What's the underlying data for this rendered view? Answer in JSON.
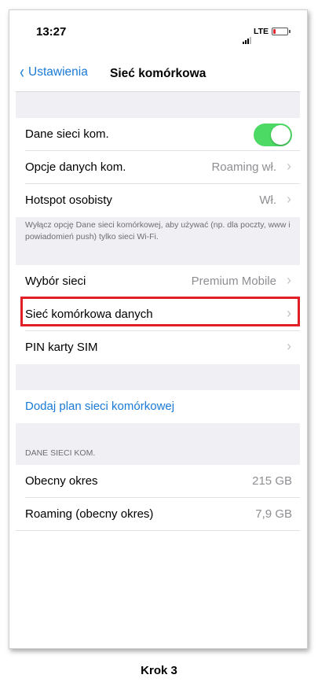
{
  "status": {
    "time": "13:27",
    "network": "LTE"
  },
  "nav": {
    "back_label": "Ustawienia",
    "title": "Sieć komórkowa"
  },
  "group1": [
    {
      "label": "Dane sieci kom.",
      "value": "",
      "toggle": true
    },
    {
      "label": "Opcje danych kom.",
      "value": "Roaming wł."
    },
    {
      "label": "Hotspot osobisty",
      "value": "Wł."
    }
  ],
  "note": "Wyłącz opcję Dane sieci komórkowej, aby używać (np. dla poczty, www i powiadomień push) tylko sieci Wi-Fi.",
  "group2": [
    {
      "label": "Wybór sieci",
      "value": "Premium Mobile"
    },
    {
      "label": "Sieć komórkowa danych",
      "value": ""
    },
    {
      "label": "PIN karty SIM",
      "value": ""
    }
  ],
  "add_plan": "Dodaj plan sieci komórkowej",
  "usage": {
    "header": "DANE SIECI KOM.",
    "rows": [
      {
        "label": "Obecny okres",
        "value": "215 GB"
      },
      {
        "label": "Roaming (obecny okres)",
        "value": "7,9 GB"
      }
    ]
  },
  "caption": "Krok 3",
  "colors": {
    "accent": "#1a7ad6",
    "toggle_on": "#4cd964",
    "highlight": "#e01f26"
  }
}
